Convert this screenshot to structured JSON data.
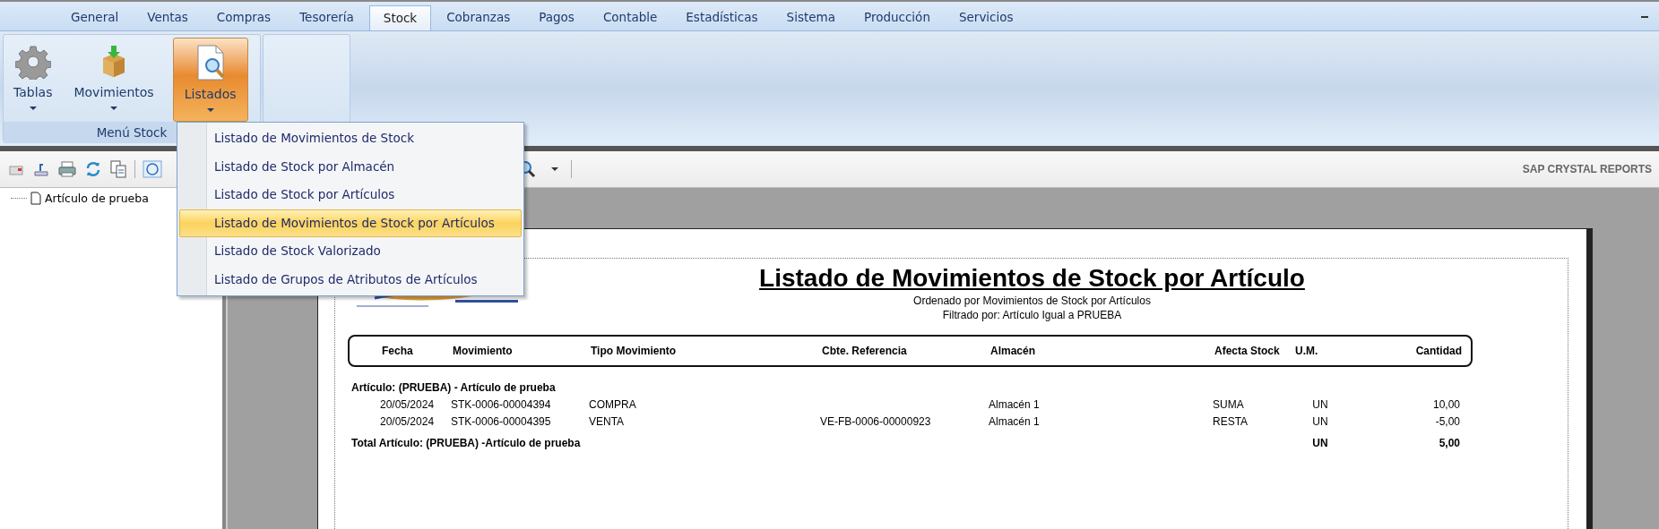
{
  "tabs": [
    {
      "label": "General",
      "selected": false
    },
    {
      "label": "Ventas",
      "selected": false
    },
    {
      "label": "Compras",
      "selected": false
    },
    {
      "label": "Tesorería",
      "selected": false
    },
    {
      "label": "Stock",
      "selected": true
    },
    {
      "label": "Cobranzas",
      "selected": false
    },
    {
      "label": "Pagos",
      "selected": false
    },
    {
      "label": "Contable",
      "selected": false
    },
    {
      "label": "Estadísticas",
      "selected": false
    },
    {
      "label": "Sistema",
      "selected": false
    },
    {
      "label": "Producción",
      "selected": false
    },
    {
      "label": "Servicios",
      "selected": false
    }
  ],
  "ribbon": {
    "group_label": "Menú Stock",
    "buttons": [
      {
        "label": "Tablas",
        "selected": false
      },
      {
        "label": "Movimientos",
        "selected": false
      },
      {
        "label": "Listados",
        "selected": true
      }
    ]
  },
  "menu": {
    "items": [
      {
        "label": "Listado de Movimientos de Stock",
        "selected": false
      },
      {
        "label": "Listado de Stock por Almacén",
        "selected": false
      },
      {
        "label": "Listado de Stock por Artículos",
        "selected": false
      },
      {
        "label": "Listado de Movimientos de Stock por Artículos",
        "selected": true
      },
      {
        "label": "Listado de Stock Valorizado",
        "selected": false
      },
      {
        "label": "Listado de Grupos de Atributos de Artículos",
        "selected": false
      }
    ]
  },
  "toolbar": {
    "brand": "SAP CRYSTAL REPORTS"
  },
  "tree": {
    "items": [
      {
        "label": "Artículo de prueba"
      }
    ]
  },
  "report": {
    "title": "Listado de Movimientos de Stock por Artículo",
    "subtitle": "Ordenado por Movimientos de Stock por Artículos",
    "filter_label": "Filtrado por:",
    "filter": "Artículo Igual a PRUEBA",
    "columns": [
      "Fecha",
      "Movimiento",
      "Tipo Movimiento",
      "Cbte. Referencia",
      "Almacén",
      "Afecta Stock",
      "U.M.",
      "Cantidad"
    ],
    "group_header": "Artículo: (PRUEBA)  - Artículo de prueba",
    "rows": [
      [
        "20/05/2024",
        "STK-0006-00004394",
        "COMPRA",
        "",
        "Almacén 1",
        "SUMA",
        "UN",
        "10,00"
      ],
      [
        "20/05/2024",
        "STK-0006-00004395",
        "VENTA",
        "VE-FB-0006-00000923",
        "Almacén 1",
        "RESTA",
        "UN",
        "-5,00"
      ]
    ],
    "total": {
      "label": "Total Artículo: (PRUEBA) -Artículo de prueba",
      "um": "UN",
      "quantity": "5,00"
    }
  }
}
